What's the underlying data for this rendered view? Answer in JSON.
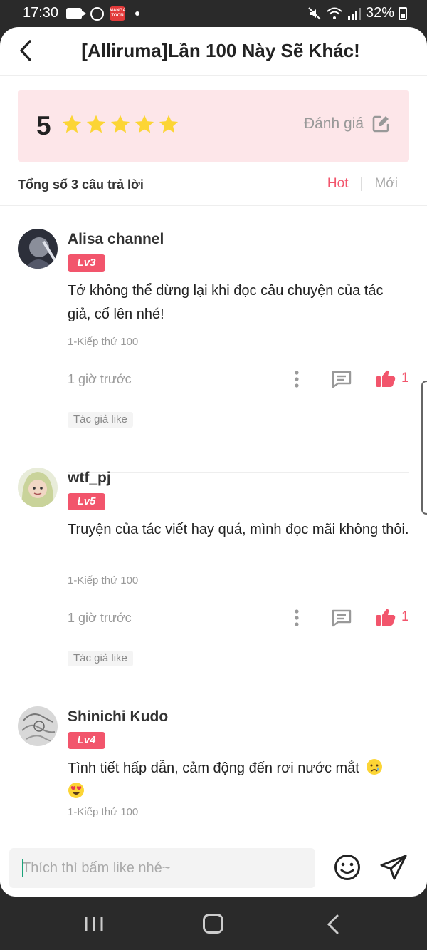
{
  "status_bar": {
    "time": "17:30",
    "battery": "32%",
    "app_icon_text": "MANGA TOON"
  },
  "header": {
    "title": "[Alliruma]Lần 100 Này Sẽ Khác!"
  },
  "rating": {
    "score": "5",
    "stars": 5,
    "rate_label": "Đánh giá"
  },
  "summary": {
    "total": "Tổng số 3 câu trả lời",
    "sort_hot": "Hot",
    "sort_new": "Mới"
  },
  "comments": [
    {
      "name": "Alisa channel",
      "level": "Lv3",
      "text": "Tớ không thể dừng lại khi đọc câu chuyện của tác giả, cố lên nhé!",
      "chapter": "1-Kiếp thứ 100",
      "time": "1 giờ trước",
      "likes": "1",
      "badge": "Tác giả like"
    },
    {
      "name": "wtf_pj",
      "level": "Lv5",
      "text": "Truyện của tác viết hay quá, mình đọc mãi không thôi.",
      "chapter": "1-Kiếp thứ 100",
      "time": "1 giờ trước",
      "likes": "1",
      "badge": "Tác giả like"
    },
    {
      "name": "Shinichi Kudo",
      "level": "Lv4",
      "text": "Tình tiết hấp dẫn, cảm động đến rơi nước mắt",
      "chapter": "1-Kiếp thứ 100",
      "emojis": [
        "crying-face",
        "heart-eyes-face"
      ]
    }
  ],
  "input": {
    "placeholder": "Thích thì bấm like nhé~"
  },
  "colors": {
    "accent": "#f2556c",
    "star": "#fcd535",
    "rating_bg": "#fde6e9"
  }
}
